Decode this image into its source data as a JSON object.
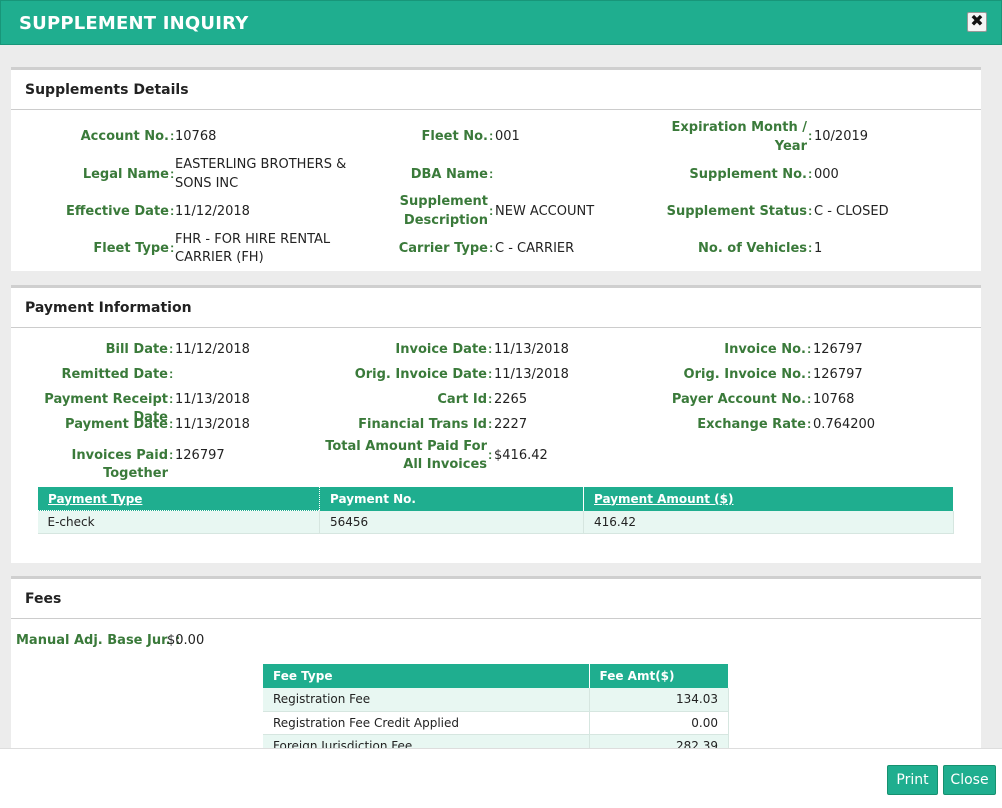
{
  "dialog": {
    "title": "SUPPLEMENT INQUIRY",
    "close_glyph": "✖"
  },
  "supplement": {
    "heading": "Supplements Details",
    "account_no": {
      "label": "Account No.",
      "value": "10768"
    },
    "legal_name": {
      "label": "Legal Name",
      "value_line1": "EASTERLING BROTHERS &",
      "value_line2": "SONS INC"
    },
    "effective_date": {
      "label": "Effective Date",
      "value": "11/12/2018"
    },
    "fleet_type": {
      "label": "Fleet Type",
      "value_line1": "FHR - FOR HIRE RENTAL",
      "value_line2": "CARRIER (FH)"
    },
    "fleet_no": {
      "label": "Fleet No.",
      "value": "001"
    },
    "dba_name": {
      "label": "DBA Name",
      "value": ""
    },
    "supplement_description": {
      "label_line1": "Supplement",
      "label_line2": "Description",
      "value": "NEW ACCOUNT"
    },
    "carrier_type": {
      "label": "Carrier Type",
      "value": "C - CARRIER"
    },
    "expiration": {
      "label_line1": "Expiration Month /",
      "label_line2": "Year",
      "value": "10/2019"
    },
    "supplement_no": {
      "label": "Supplement No.",
      "value": "000"
    },
    "supplement_status": {
      "label": "Supplement Status",
      "value": "C - CLOSED"
    },
    "no_of_vehicles": {
      "label": "No. of Vehicles",
      "value": "1"
    }
  },
  "payment": {
    "heading": "Payment Information",
    "bill_date": {
      "label": "Bill Date",
      "value": "11/12/2018"
    },
    "remitted_date": {
      "label": "Remitted Date",
      "value": ""
    },
    "payment_receipt_date": {
      "label": "Payment Receipt Date",
      "value": "11/13/2018"
    },
    "payment_date": {
      "label": "Payment Date",
      "value": "11/13/2018"
    },
    "invoices_paid_together": {
      "label": "Invoices Paid Together",
      "value": "126797"
    },
    "invoice_date": {
      "label": "Invoice Date",
      "value": "11/13/2018"
    },
    "orig_invoice_date": {
      "label": "Orig. Invoice Date",
      "value": "11/13/2018"
    },
    "cart_id": {
      "label": "Cart Id",
      "value": "2265"
    },
    "financial_trans_id": {
      "label": "Financial Trans Id",
      "value": "2227"
    },
    "total_amount_paid": {
      "label_line1": "Total Amount Paid For",
      "label_line2": "All Invoices",
      "value": "$416.42"
    },
    "invoice_no": {
      "label": "Invoice No.",
      "value": "126797"
    },
    "orig_invoice_no": {
      "label": "Orig. Invoice No.",
      "value": "126797"
    },
    "payer_account_no": {
      "label": "Payer Account No.",
      "value": "10768"
    },
    "exchange_rate": {
      "label": "Exchange Rate",
      "value": "0.764200"
    },
    "table": {
      "headers": [
        "Payment Type",
        "Payment No.",
        "Payment Amount ($)"
      ],
      "rows": [
        [
          "E-check",
          "56456",
          "416.42"
        ]
      ]
    }
  },
  "fees": {
    "heading": "Fees",
    "manual_adj": {
      "label": "Manual Adj. Base Jur. :",
      "value": "$0.00"
    },
    "table": {
      "headers": [
        "Fee Type",
        "Fee Amt($)"
      ],
      "rows": [
        [
          "Registration Fee",
          "134.03"
        ],
        [
          "Registration Fee Credit Applied",
          "0.00"
        ],
        [
          "Foreign Jurisdiction Fee",
          "282.39"
        ]
      ]
    }
  },
  "footer": {
    "print_label": "Print",
    "close_label": "Close"
  },
  "colors": {
    "accent": "#1fae8f",
    "label_green": "#3a7a3a",
    "row_tint": "#e8f7f2"
  }
}
